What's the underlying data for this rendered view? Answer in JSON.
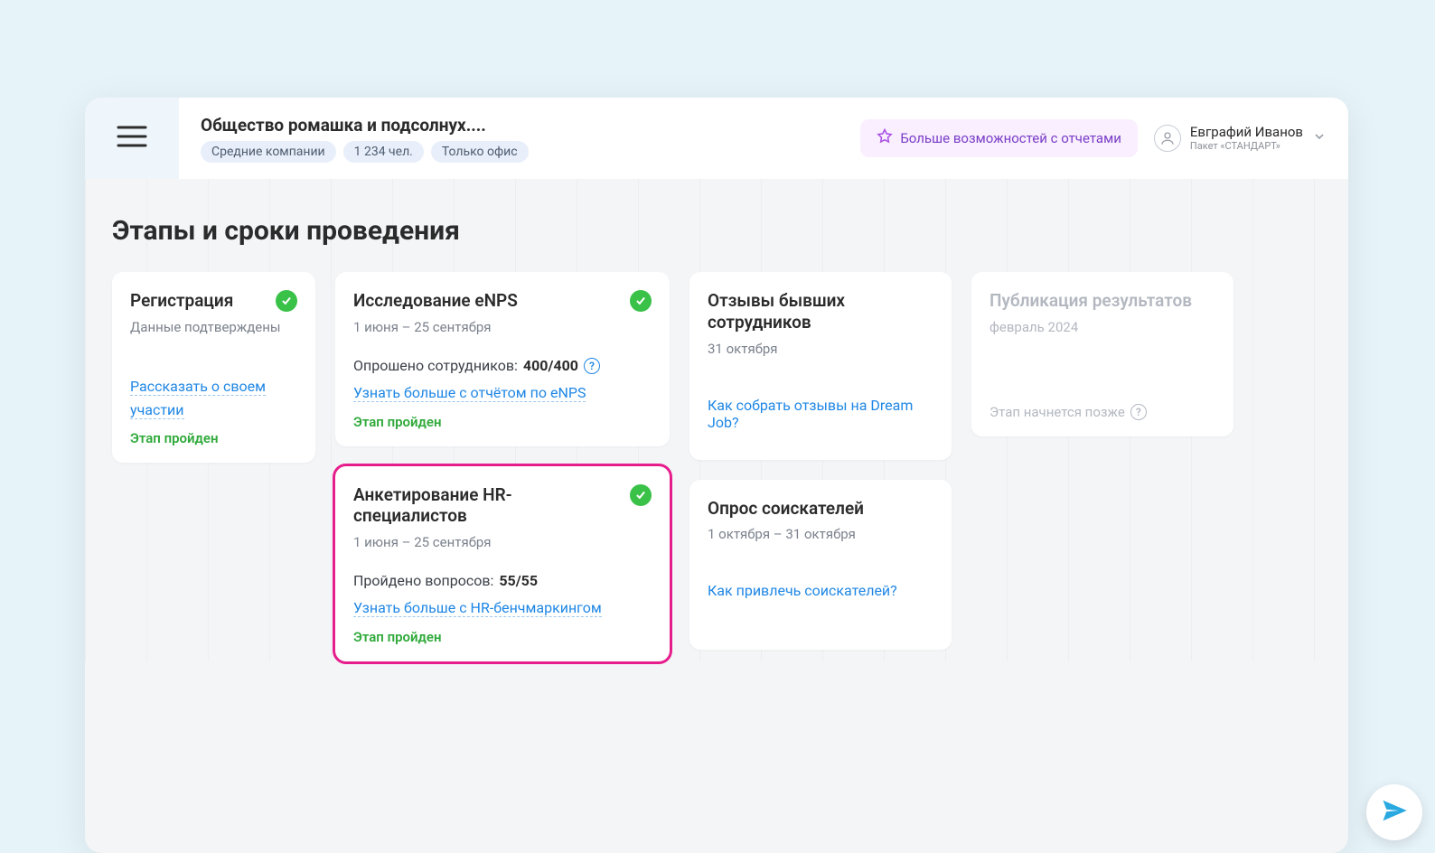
{
  "header": {
    "org_title": "Общество ромашка и подсолнух....",
    "chips": [
      "Средние компании",
      "1 234 чел.",
      "Только офис"
    ],
    "promo": "Больше возможностей с отчетами",
    "user_name": "Евграфий Иванов",
    "user_plan": "Пакет «СТАНДАРТ»"
  },
  "page_title": "Этапы и сроки проведения",
  "cards": {
    "registration": {
      "title": "Регистрация",
      "subtitle": "Данные подтверждены",
      "link": "Рассказать о своем участии",
      "status": "Этап пройден"
    },
    "enps": {
      "title": "Исследование eNPS",
      "subtitle": "1 июня – 25 сентября",
      "metric_label": "Опрошено сотрудников:",
      "metric_value": "400/400",
      "link": "Узнать больше с отчётом по eNPS",
      "status": "Этап пройден"
    },
    "hr_survey": {
      "title": "Анкетирование HR-специалистов",
      "subtitle": "1 июня – 25 сентября",
      "metric_label": "Пройдено вопросов:",
      "metric_value": "55/55",
      "link": "Узнать больше с HR-бенчмаркингом",
      "status": "Этап пройден"
    },
    "former": {
      "title": "Отзывы бывших сотрудников",
      "subtitle": "31 октября",
      "link": "Как собрать отзывы на Dream Job?"
    },
    "candidates": {
      "title": "Опрос соискателей",
      "subtitle": "1 октября – 31 октября",
      "link": "Как привлечь соискателей?"
    },
    "publication": {
      "title": "Публикация результатов",
      "subtitle": "февраль 2024",
      "status": "Этап начнется позже"
    }
  }
}
